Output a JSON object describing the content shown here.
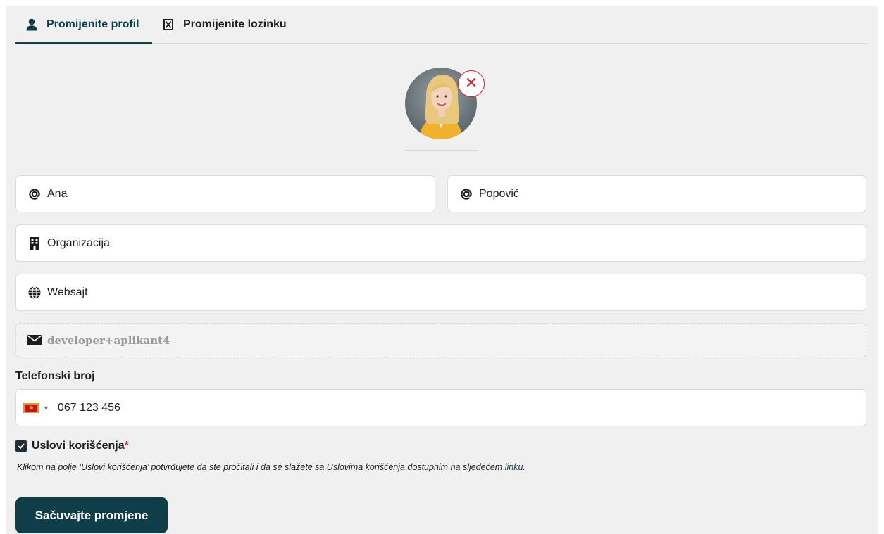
{
  "tabs": {
    "profile_label": "Promijenite profil",
    "password_label": "Promijenite lozinku"
  },
  "form": {
    "first_name": "Ana",
    "last_name": "Popović",
    "organization_placeholder": "Organizacija",
    "website_placeholder": "Websajt",
    "email": "developer+aplikant4",
    "phone_label": "Telefonski broj",
    "phone_value": "067 123 456",
    "terms_label": "Uslovi korišćenja",
    "terms_required_mark": "*",
    "terms_note_prefix": "Klikom na polje ‘Uslovi korišćenja’ potvrđujete da ste pročitali i da se slažete sa Uslovima korišćenja dostupnim na sljedećem",
    "terms_link": "linku",
    "terms_note_suffix": ".",
    "save_label": "Sačuvajte promjene"
  },
  "colors": {
    "primary": "#0f3d48",
    "danger": "#d01f2a",
    "background": "#f0f0f0"
  },
  "icons": {
    "profile_tab": "user-icon",
    "password_tab": "lock-icon",
    "first_name": "at-icon",
    "last_name": "at-icon",
    "organization": "building-icon",
    "website": "globe-icon",
    "email": "envelope-icon",
    "remove_photo": "close-icon",
    "phone_country": "montenegro-flag-icon"
  }
}
